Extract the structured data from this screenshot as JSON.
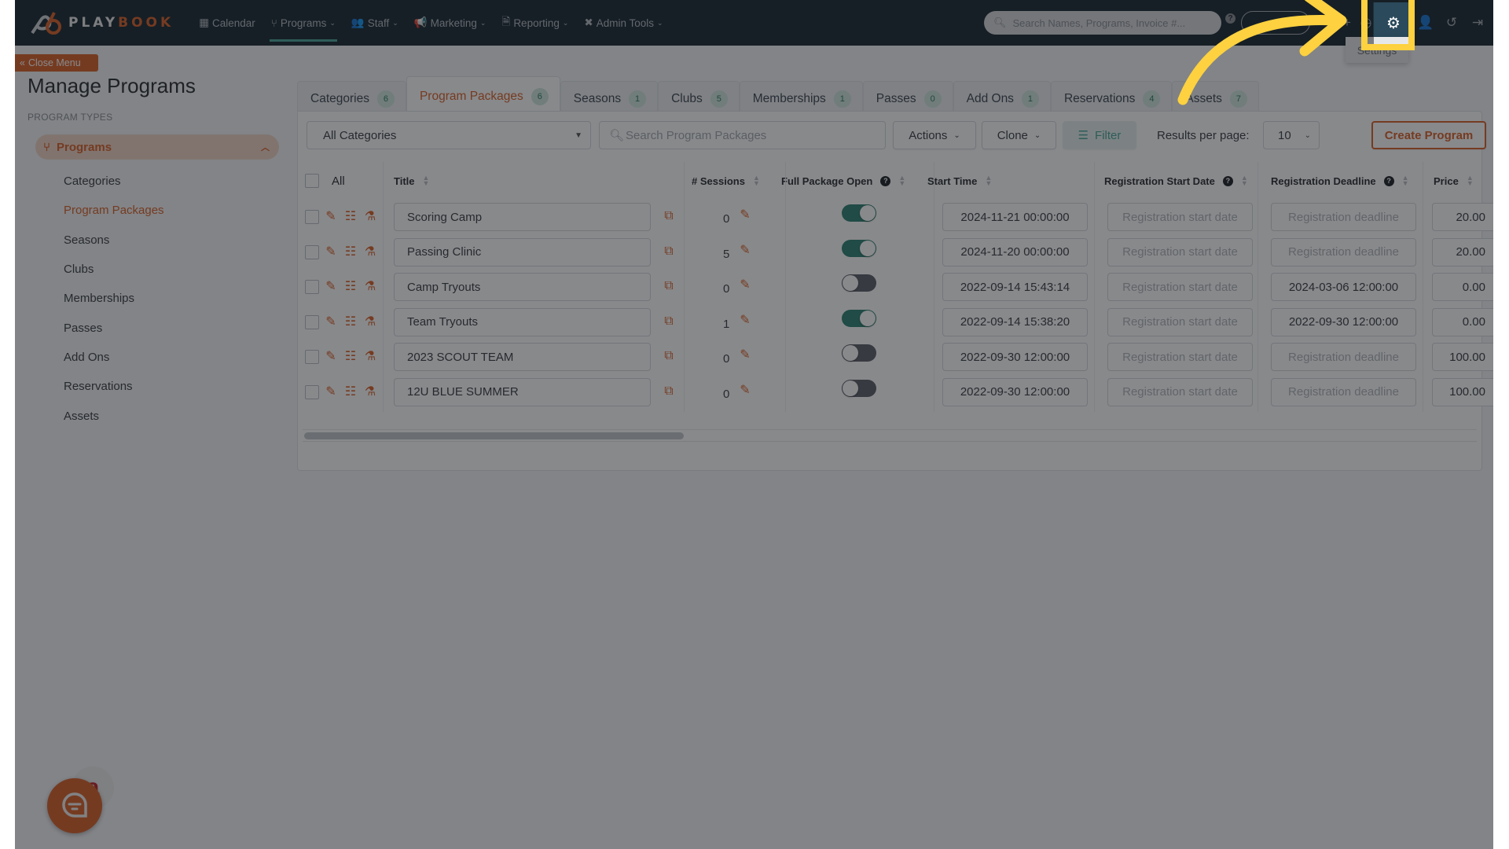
{
  "brand": {
    "name_left": "PLAY",
    "name_right": "BOOK"
  },
  "nav": [
    {
      "label": "Calendar",
      "icon": "calendar-icon",
      "dropdown": false,
      "active": false
    },
    {
      "label": "Programs",
      "icon": "branch-icon",
      "dropdown": true,
      "active": true
    },
    {
      "label": "Staff",
      "icon": "users-icon",
      "dropdown": true,
      "active": false
    },
    {
      "label": "Marketing",
      "icon": "bullhorn-icon",
      "dropdown": true,
      "active": false
    },
    {
      "label": "Reporting",
      "icon": "file-icon",
      "dropdown": true,
      "active": false
    },
    {
      "label": "Admin Tools",
      "icon": "tools-icon",
      "dropdown": true,
      "active": false
    }
  ],
  "header": {
    "search_placeholder": "Search Names, Programs, Invoice #...",
    "pill_button_label": "",
    "settings_tooltip": "Settings",
    "icons": [
      "help-icon",
      "add-icon",
      "clock-icon",
      "gear-icon",
      "add-user-icon",
      "history-icon",
      "logout-icon"
    ]
  },
  "sidebar": {
    "close_menu_label": "Close Menu",
    "page_title": "Manage Programs",
    "section_label": "PROGRAM TYPES",
    "group_label": "Programs",
    "items": [
      {
        "label": "Categories",
        "active": false
      },
      {
        "label": "Program Packages",
        "active": true
      },
      {
        "label": "Seasons",
        "active": false
      },
      {
        "label": "Clubs",
        "active": false
      },
      {
        "label": "Memberships",
        "active": false
      },
      {
        "label": "Passes",
        "active": false
      },
      {
        "label": "Add Ons",
        "active": false
      },
      {
        "label": "Reservations",
        "active": false
      },
      {
        "label": "Assets",
        "active": false
      }
    ]
  },
  "tabs": [
    {
      "label": "Categories",
      "count": "6",
      "active": false
    },
    {
      "label": "Program Packages",
      "count": "6",
      "active": true
    },
    {
      "label": "Seasons",
      "count": "1",
      "active": false
    },
    {
      "label": "Clubs",
      "count": "5",
      "active": false
    },
    {
      "label": "Memberships",
      "count": "1",
      "active": false
    },
    {
      "label": "Passes",
      "count": "0",
      "active": false
    },
    {
      "label": "Add Ons",
      "count": "1",
      "active": false
    },
    {
      "label": "Reservations",
      "count": "4",
      "active": false
    },
    {
      "label": "Assets",
      "count": "7",
      "active": false
    }
  ],
  "toolbar": {
    "category_select": "All Categories",
    "search_placeholder": "Search Program Packages",
    "actions_label": "Actions",
    "clone_label": "Clone",
    "filter_label": "Filter",
    "results_per_page_label": "Results per page:",
    "results_per_page_value": "10",
    "create_label": "Create Program"
  },
  "table": {
    "select_all_label": "All",
    "columns": {
      "title": "Title",
      "sessions": "# Sessions",
      "full_package_open": "Full Package Open",
      "start_time": "Start Time",
      "reg_start": "Registration Start Date",
      "reg_deadline": "Registration Deadline",
      "price": "Price"
    },
    "reg_start_placeholder": "Registration start date",
    "reg_deadline_placeholder": "Registration deadline",
    "rows": [
      {
        "title": "Scoring Camp",
        "sessions": "0",
        "open": true,
        "start": "2024-11-21 00:00:00",
        "reg_start": "",
        "reg_deadline": "",
        "price": "20.00"
      },
      {
        "title": "Passing Clinic",
        "sessions": "5",
        "open": true,
        "start": "2024-11-20 00:00:00",
        "reg_start": "",
        "reg_deadline": "",
        "price": "20.00"
      },
      {
        "title": "Camp Tryouts",
        "sessions": "0",
        "open": false,
        "start": "2022-09-14 15:43:14",
        "reg_start": "",
        "reg_deadline": "2024-03-06 12:00:00",
        "price": "0.00"
      },
      {
        "title": "Team Tryouts",
        "sessions": "1",
        "open": true,
        "start": "2022-09-14 15:38:20",
        "reg_start": "",
        "reg_deadline": "2022-09-30 12:00:00",
        "price": "0.00"
      },
      {
        "title": "2023 SCOUT TEAM",
        "sessions": "0",
        "open": false,
        "start": "2022-09-30 12:00:00",
        "reg_start": "",
        "reg_deadline": "",
        "price": "100.00"
      },
      {
        "title": "12U BLUE SUMMER",
        "sessions": "0",
        "open": false,
        "start": "2022-09-30 12:00:00",
        "reg_start": "",
        "reg_deadline": "",
        "price": "100.00"
      }
    ]
  },
  "colors": {
    "brand_orange": "#d9622b",
    "teal": "#2f8374",
    "header_bg": "#1b2a35",
    "annotation_yellow": "#fdd13f"
  }
}
